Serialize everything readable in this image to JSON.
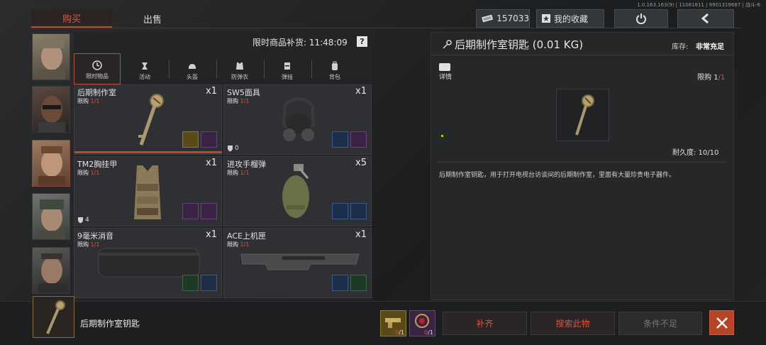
{
  "build_info": "1.0.163.163(9) | 11081811 | 9901319687 | 战斗-6",
  "tabs": {
    "buy": "购买",
    "sell": "出售"
  },
  "currency": {
    "amount": "157033",
    "icon": "banknote-icon"
  },
  "favorites_label": "我的收藏",
  "restock": {
    "label": "限时商品补货: 11:48:09",
    "help": "?"
  },
  "categories": [
    {
      "label": "限时物品",
      "icon": "clock-icon"
    },
    {
      "label": "活动",
      "icon": "event-icon"
    },
    {
      "label": "头盔",
      "icon": "helmet-icon"
    },
    {
      "label": "防弹衣",
      "icon": "vest-icon"
    },
    {
      "label": "弹挂",
      "icon": "rig-icon"
    },
    {
      "label": "背包",
      "icon": "backpack-icon"
    }
  ],
  "items": [
    {
      "name": "后期制作室",
      "limit_label": "限购",
      "limit": "1/1",
      "qty": "x1",
      "armor": ""
    },
    {
      "name": "SW5面具",
      "limit_label": "限购",
      "limit": "1/1",
      "qty": "x1",
      "armor": "0"
    },
    {
      "name": "TM2胸挂甲",
      "limit_label": "限购",
      "limit": "1/1",
      "qty": "x1",
      "armor": "4"
    },
    {
      "name": "进攻手榴弹",
      "limit_label": "限购",
      "limit": "1/1",
      "qty": "x5",
      "armor": ""
    },
    {
      "name": "9毫米消音",
      "limit_label": "限购",
      "limit": "1/1",
      "qty": "x1",
      "armor": ""
    },
    {
      "name": "ACE上机匣",
      "limit_label": "限购",
      "limit": "1/1",
      "qty": "x1",
      "armor": ""
    }
  ],
  "detail": {
    "title": "后期制作室钥匙 (0.01 KG)",
    "stock_label": "库存:",
    "stock_value": "非常充足",
    "details_label": "详情",
    "limit_label": "限购",
    "limit_have": "1",
    "limit_total": "/1",
    "durability": "耐久度:  10/10",
    "description": "后期制作室钥匙，用于打开电视台访谈间的后期制作室，里面有大量珍贵电子器件。"
  },
  "bottom": {
    "item_name": "后期制作室钥匙",
    "req1": {
      "have": "0",
      "need": "/1"
    },
    "req2": {
      "have": "0",
      "need": "/1"
    },
    "fill_label": "补齐",
    "search_label": "搜索此物",
    "cond_label": "条件不足"
  }
}
